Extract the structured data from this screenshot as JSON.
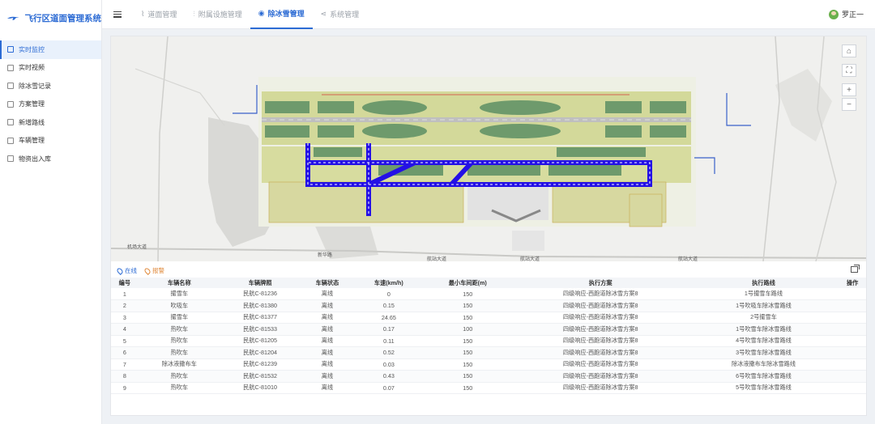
{
  "app": {
    "title": "飞行区道面管理系统"
  },
  "sidebar": {
    "items": [
      {
        "label": "实时监控",
        "icon": "monitor-icon",
        "active": true
      },
      {
        "label": "实时视频",
        "icon": "video-icon",
        "active": false
      },
      {
        "label": "除冰雪记录",
        "icon": "record-icon",
        "active": false
      },
      {
        "label": "方案管理",
        "icon": "plan-icon",
        "active": false
      },
      {
        "label": "新增路线",
        "icon": "route-icon",
        "active": false
      },
      {
        "label": "车辆管理",
        "icon": "vehicle-icon",
        "active": false
      },
      {
        "label": "物资出入库",
        "icon": "warehouse-icon",
        "active": false
      }
    ]
  },
  "header": {
    "tabs": [
      {
        "label": "道面管理",
        "icon": "road-icon",
        "active": false
      },
      {
        "label": "附属设施管理",
        "icon": "facility-icon",
        "active": false
      },
      {
        "label": "除冰雪管理",
        "icon": "snow-icon",
        "active": true
      },
      {
        "label": "系统管理",
        "icon": "settings-icon",
        "active": false
      }
    ],
    "user": "罗正一"
  },
  "map": {
    "road_labels": [
      "机场大道",
      "航站大道",
      "航站大道",
      "航站大道",
      "新华路"
    ],
    "controls": [
      "home-icon",
      "fullscreen-icon",
      "zoom-in-icon",
      "zoom-out-icon"
    ]
  },
  "legend": {
    "online": "在线",
    "alarm": "报警"
  },
  "table": {
    "headers": [
      "编号",
      "车辆名称",
      "车辆牌照",
      "车辆状态",
      "车速(km/h)",
      "最小车间距(m)",
      "执行方案",
      "执行路线",
      "操作"
    ],
    "rows": [
      [
        "1",
        "撮雪车",
        "民航C-81236",
        "离线",
        "0",
        "150",
        "四级响应-西跑道除冰雪方案8",
        "1号撮雪车路线",
        ""
      ],
      [
        "2",
        "吹吸车",
        "民航C-81380",
        "离线",
        "0.15",
        "150",
        "四级响应-西跑道除冰雪方案8",
        "1号吹吸车除冰雪路线",
        ""
      ],
      [
        "3",
        "撮雪车",
        "民航C-81377",
        "离线",
        "24.65",
        "150",
        "四级响应-西跑道除冰雪方案8",
        "2号撮雪车",
        ""
      ],
      [
        "4",
        "热吹车",
        "民航C-81533",
        "离线",
        "0.17",
        "100",
        "四级响应-西跑道除冰雪方案8",
        "1号吹雪车除冰雪路线",
        ""
      ],
      [
        "5",
        "热吹车",
        "民航C-81205",
        "离线",
        "0.11",
        "150",
        "四级响应-西跑道除冰雪方案8",
        "4号吹雪车除冰雪路线",
        ""
      ],
      [
        "6",
        "热吹车",
        "民航C-81204",
        "离线",
        "0.52",
        "150",
        "四级响应-西跑道除冰雪方案8",
        "3号吹雪车除冰雪路线",
        ""
      ],
      [
        "7",
        "除冰液撒布车",
        "民航C-81239",
        "离线",
        "0.03",
        "150",
        "四级响应-西跑道除冰雪方案8",
        "除冰液撒布车除冰雪路线",
        ""
      ],
      [
        "8",
        "热吹车",
        "民航C-81532",
        "离线",
        "0.43",
        "150",
        "四级响应-西跑道除冰雪方案8",
        "6号吹雪车除冰雪路线",
        ""
      ],
      [
        "9",
        "热吹车",
        "民航C-81010",
        "离线",
        "0.07",
        "150",
        "四级响应-西跑道除冰雪方案8",
        "5号吹雪车除冰雪路线",
        ""
      ]
    ]
  },
  "colors": {
    "accent": "#2c6bd4",
    "route": "#2410e6",
    "taxiway": "#c9d28a",
    "grass": "#6e9a6c"
  }
}
